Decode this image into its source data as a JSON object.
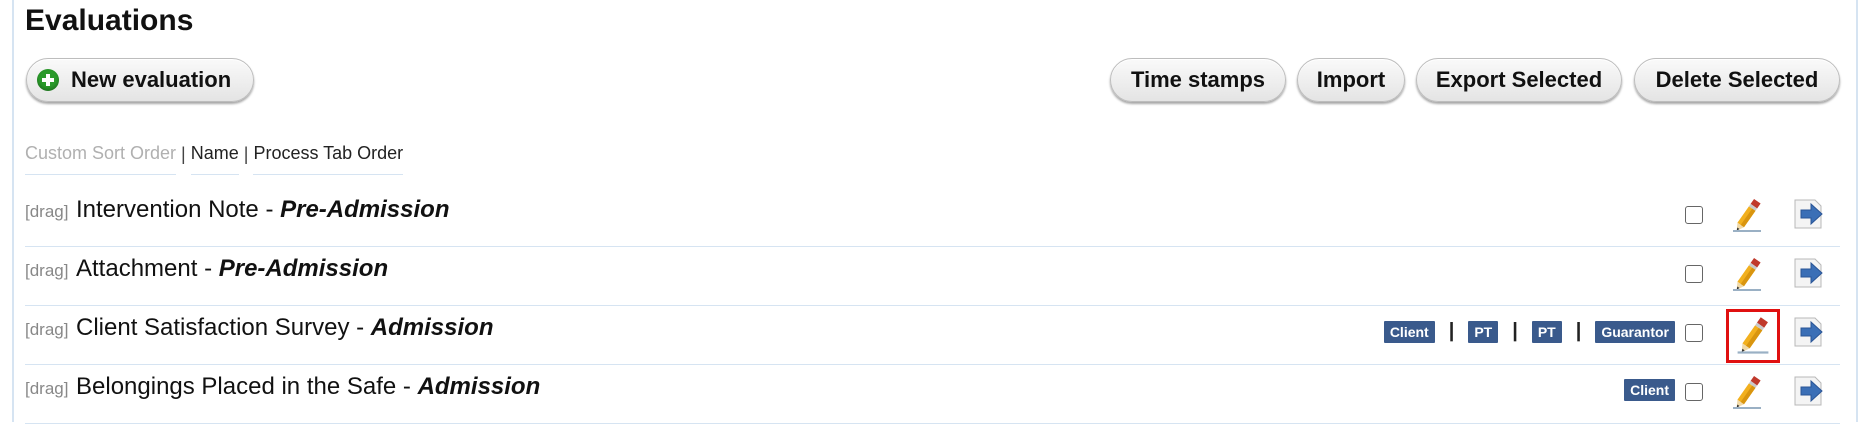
{
  "page": {
    "title": "Evaluations"
  },
  "toolbar": {
    "new_label": "New evaluation",
    "timestamps_label": "Time stamps",
    "import_label": "Import",
    "export_label": "Export Selected",
    "delete_label": "Delete Selected"
  },
  "sort": {
    "options": [
      "Custom Sort Order",
      "Name",
      "Process Tab Order"
    ],
    "separator": "|",
    "active": "Custom Sort Order"
  },
  "colors": {
    "tag_bg": "#3a5a8c",
    "highlight": "#e01010",
    "plus_green": "#2a9a2a"
  },
  "rows": [
    {
      "drag": "[drag]",
      "name": "Intervention Note",
      "dash": " - ",
      "phase": "Pre-Admission",
      "tags": [],
      "checked": false,
      "highlighted": false
    },
    {
      "drag": "[drag]",
      "name": "Attachment",
      "dash": " - ",
      "phase": "Pre-Admission",
      "tags": [],
      "checked": false,
      "highlighted": false
    },
    {
      "drag": "[drag]",
      "name": "Client Satisfaction Survey",
      "dash": " - ",
      "phase": "Admission",
      "tags": [
        "Client",
        "PT",
        "PT",
        "Guarantor"
      ],
      "checked": false,
      "highlighted": true
    },
    {
      "drag": "[drag]",
      "name": "Belongings Placed in the Safe",
      "dash": " - ",
      "phase": "Admission",
      "tags": [
        "Client"
      ],
      "checked": false,
      "highlighted": false
    }
  ],
  "icons": {
    "edit": "pencil-icon",
    "open": "arrow-right-icon",
    "new": "plus-circle-icon"
  }
}
